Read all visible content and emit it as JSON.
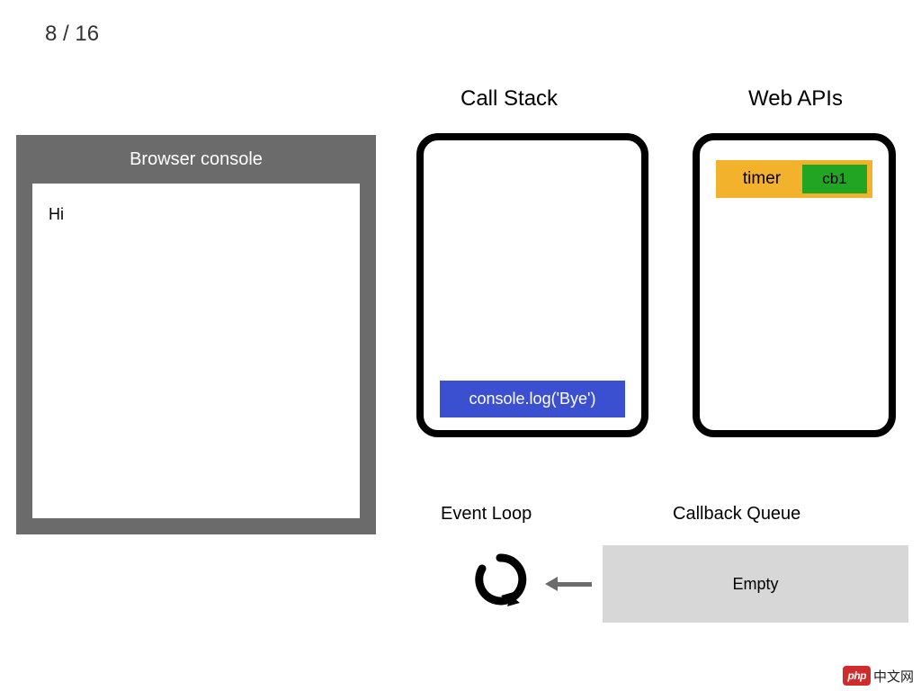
{
  "step": "8 / 16",
  "labels": {
    "callStack": "Call Stack",
    "webApis": "Web APIs",
    "eventLoop": "Event Loop",
    "callbackQueue": "Callback Queue"
  },
  "browser": {
    "title": "Browser console",
    "output": "Hi"
  },
  "callStack": {
    "items": [
      "console.log('Bye')"
    ]
  },
  "webApis": {
    "timer": {
      "label": "timer",
      "callback": "cb1"
    }
  },
  "queue": {
    "state": "Empty"
  },
  "logo": {
    "badge": "php",
    "text": "中文网"
  }
}
